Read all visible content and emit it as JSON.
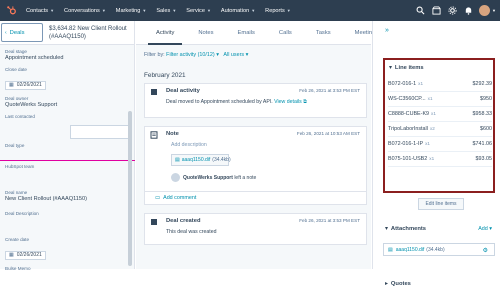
{
  "nav": {
    "items": [
      "Contacts",
      "Conversations",
      "Marketing",
      "Sales",
      "Service",
      "Automation",
      "Reports"
    ]
  },
  "record": {
    "back_label": "Deals",
    "title": "$3,634.82 New Client Rollout (#AAAQ1150)",
    "fields": [
      {
        "label": "Deal stage",
        "value": "Appointment scheduled"
      },
      {
        "label": "Close date",
        "value": "02/26/2021",
        "type": "date"
      },
      {
        "label": "Deal owner",
        "value": "QuoteWerks Support"
      },
      {
        "label": "Last contacted",
        "value": ""
      },
      {
        "label": "Deal type",
        "value": ""
      },
      {
        "label": "HubSpot team",
        "value": ""
      },
      {
        "label": "Deal name",
        "value": "New Client Rollout (#AAAQ1150)"
      },
      {
        "label": "Deal Description",
        "value": ""
      },
      {
        "label": "Create date",
        "value": "02/26/2021",
        "type": "date"
      },
      {
        "label": "Bulse Memo",
        "value": ""
      }
    ]
  },
  "timeline": {
    "tabs": [
      "Activity",
      "Notes",
      "Emails",
      "Calls",
      "Tasks",
      "Meetings"
    ],
    "filter_prefix": "Filter by:",
    "filter_activity": "Filter activity (10/12)",
    "filter_users": "All users",
    "month": "February 2021",
    "deal_activity": {
      "title": "Deal activity",
      "time": "Feb 26, 2021 at 3:53 PM EST",
      "text": "Deal moved to Appointment scheduled by API.",
      "link": "View details"
    },
    "note": {
      "title": "Note",
      "time": "Feb 26, 2021 at 10:53 AM EST",
      "placeholder": "Add description",
      "attachment_name": "aaaq1150.dif",
      "attachment_size": "(34.4kb)",
      "author": "QuoteWerks Support",
      "author_suffix": "left a note",
      "comment_label": "Add comment"
    },
    "deal_created": {
      "title": "Deal created",
      "time": "Feb 26, 2021 at 3:53 PM EST",
      "text": "This deal was created"
    }
  },
  "sidebar": {
    "line_items_title": "Line items",
    "line_items": [
      {
        "name": "B072-016-1",
        "qty": "x1",
        "price": "$292.39"
      },
      {
        "name": "WS-C3560CP...",
        "qty": "x1",
        "price": "$950"
      },
      {
        "name": "C8888-CUBE-K9",
        "qty": "x1",
        "price": "$958.33"
      },
      {
        "name": "TripoLaborInstall",
        "qty": "x2",
        "price": "$600"
      },
      {
        "name": "B072-016-1-IP",
        "qty": "x1",
        "price": "$741.06"
      },
      {
        "name": "B075-101-USB2",
        "qty": "x1",
        "price": "$93.05"
      }
    ],
    "edit_button": "Edit line items",
    "attachments_title": "Attachments",
    "add_label": "Add",
    "attachment_name": "aaaq1150.dif",
    "attachment_size": "(34.4kb)",
    "quotes_title": "Quotes"
  }
}
